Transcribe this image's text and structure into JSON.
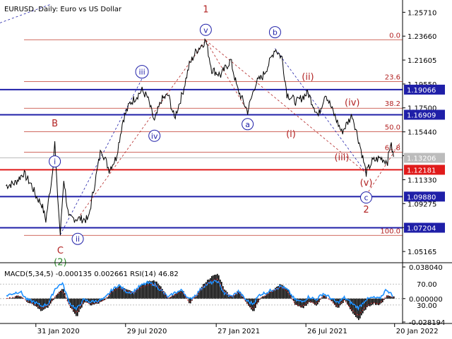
{
  "chart_data": {
    "type": "line",
    "title": "EURUSD, Daily:  Euro vs US Dollar",
    "price_axis": {
      "ticks": [
        "1.25710",
        "1.23660",
        "1.21605",
        "1.19550",
        "1.17500",
        "1.15440",
        "1.13390",
        "1.11330",
        "1.09275",
        "1.07220",
        "1.05165"
      ],
      "ylim": [
        1.042,
        1.264
      ]
    },
    "time_axis": {
      "ticks": [
        "31 Jan 2020",
        "29 Jul 2020",
        "27 Jan 2021",
        "26 Jul 2021",
        "20 Jan 2022"
      ]
    },
    "fib_levels": [
      {
        "label": "0.0",
        "price": 1.2335
      },
      {
        "label": "23.6",
        "price": 1.1975
      },
      {
        "label": "38.2",
        "price": 1.1747
      },
      {
        "label": "50.0",
        "price": 1.1545
      },
      {
        "label": "61.8",
        "price": 1.137
      },
      {
        "label": "100.0",
        "price": 1.0655
      }
    ],
    "horizontal_levels": [
      {
        "price": 1.19066,
        "label": "1.19066",
        "color": "#1f1fa8"
      },
      {
        "price": 1.16909,
        "label": "1.16909",
        "color": "#1f1fa8"
      },
      {
        "price": 1.12181,
        "label": "1.12181",
        "color": "#e01b1b"
      },
      {
        "price": 1.0988,
        "label": "1.09880",
        "color": "#1f1fa8"
      },
      {
        "price": 1.07204,
        "label": "1.07204",
        "color": "#1f1fa8"
      }
    ],
    "current_price": {
      "price": 1.13206,
      "label": "1.13206",
      "color": "#bcbcbc"
    },
    "price_series": [
      {
        "date": "2019-12-02",
        "close": 1.1082
      },
      {
        "date": "2019-12-20",
        "close": 1.1105
      },
      {
        "date": "2020-01-06",
        "close": 1.119
      },
      {
        "date": "2020-01-22",
        "close": 1.109
      },
      {
        "date": "2020-01-31",
        "close": 1.0995
      },
      {
        "date": "2020-02-12",
        "close": 1.092
      },
      {
        "date": "2020-02-20",
        "close": 1.0785
      },
      {
        "date": "2020-03-03",
        "close": 1.115
      },
      {
        "date": "2020-03-09",
        "close": 1.145
      },
      {
        "date": "2020-03-13",
        "close": 1.11
      },
      {
        "date": "2020-03-20",
        "close": 1.066
      },
      {
        "date": "2020-03-27",
        "close": 1.114
      },
      {
        "date": "2020-04-06",
        "close": 1.08
      },
      {
        "date": "2020-04-24",
        "close": 1.08
      },
      {
        "date": "2020-05-15",
        "close": 1.079
      },
      {
        "date": "2020-05-29",
        "close": 1.112
      },
      {
        "date": "2020-06-10",
        "close": 1.14
      },
      {
        "date": "2020-06-26",
        "close": 1.122
      },
      {
        "date": "2020-07-10",
        "close": 1.132
      },
      {
        "date": "2020-07-24",
        "close": 1.165
      },
      {
        "date": "2020-08-07",
        "close": 1.179
      },
      {
        "date": "2020-08-31",
        "close": 1.19
      },
      {
        "date": "2020-09-11",
        "close": 1.184
      },
      {
        "date": "2020-09-25",
        "close": 1.163
      },
      {
        "date": "2020-10-09",
        "close": 1.182
      },
      {
        "date": "2020-10-23",
        "close": 1.186
      },
      {
        "date": "2020-11-04",
        "close": 1.166
      },
      {
        "date": "2020-11-20",
        "close": 1.187
      },
      {
        "date": "2020-12-04",
        "close": 1.212
      },
      {
        "date": "2020-12-18",
        "close": 1.224
      },
      {
        "date": "2021-01-06",
        "close": 1.233
      },
      {
        "date": "2021-01-18",
        "close": 1.208
      },
      {
        "date": "2021-02-05",
        "close": 1.203
      },
      {
        "date": "2021-02-25",
        "close": 1.216
      },
      {
        "date": "2021-03-10",
        "close": 1.192
      },
      {
        "date": "2021-03-31",
        "close": 1.172
      },
      {
        "date": "2021-04-16",
        "close": 1.196
      },
      {
        "date": "2021-04-30",
        "close": 1.202
      },
      {
        "date": "2021-05-14",
        "close": 1.214
      },
      {
        "date": "2021-05-25",
        "close": 1.226
      },
      {
        "date": "2021-06-08",
        "close": 1.218
      },
      {
        "date": "2021-06-18",
        "close": 1.187
      },
      {
        "date": "2021-07-07",
        "close": 1.18
      },
      {
        "date": "2021-07-30",
        "close": 1.188
      },
      {
        "date": "2021-08-20",
        "close": 1.168
      },
      {
        "date": "2021-09-03",
        "close": 1.188
      },
      {
        "date": "2021-09-17",
        "close": 1.173
      },
      {
        "date": "2021-10-06",
        "close": 1.154
      },
      {
        "date": "2021-10-27",
        "close": 1.169
      },
      {
        "date": "2021-11-12",
        "close": 1.142
      },
      {
        "date": "2021-11-24",
        "close": 1.119
      },
      {
        "date": "2021-12-06",
        "close": 1.129
      },
      {
        "date": "2021-12-22",
        "close": 1.132
      },
      {
        "date": "2022-01-06",
        "close": 1.129
      },
      {
        "date": "2022-01-12",
        "close": 1.145
      },
      {
        "date": "2022-01-18",
        "close": 1.133
      }
    ],
    "wave_labels": [
      {
        "text": "B",
        "date": "2020-03-09",
        "price": 1.162,
        "color": "#b22222",
        "circle": false
      },
      {
        "text": "i",
        "date": "2020-03-09",
        "price": 1.129,
        "color": "#1f1fa8",
        "circle": true
      },
      {
        "text": "C",
        "date": "2020-03-20",
        "price": 1.053,
        "color": "#b22222",
        "circle": false
      },
      {
        "text": "(2)",
        "date": "2020-03-20",
        "price": 1.043,
        "color": "#2e8b2e",
        "circle": false
      },
      {
        "text": "ii",
        "date": "2020-04-24",
        "price": 1.0625,
        "color": "#1f1fa8",
        "circle": true
      },
      {
        "text": "iii",
        "date": "2020-08-31",
        "price": 1.206,
        "color": "#1f1fa8",
        "circle": true
      },
      {
        "text": "iv",
        "date": "2020-09-25",
        "price": 1.151,
        "color": "#1f1fa8",
        "circle": true
      },
      {
        "text": "1",
        "date": "2021-01-06",
        "price": 1.26,
        "color": "#b22222",
        "circle": false
      },
      {
        "text": "v",
        "date": "2021-01-06",
        "price": 1.242,
        "color": "#1f1fa8",
        "circle": true
      },
      {
        "text": "a",
        "date": "2021-03-31",
        "price": 1.161,
        "color": "#1f1fa8",
        "circle": true
      },
      {
        "text": "b",
        "date": "2021-05-25",
        "price": 1.24,
        "color": "#1f1fa8",
        "circle": true
      },
      {
        "text": "(ii)",
        "date": "2021-07-30",
        "price": 1.202,
        "color": "#b22222",
        "circle": false
      },
      {
        "text": "(i)",
        "date": "2021-06-26",
        "price": 1.153,
        "color": "#b22222",
        "circle": false
      },
      {
        "text": "(iv)",
        "date": "2021-10-27",
        "price": 1.18,
        "color": "#b22222",
        "circle": false
      },
      {
        "text": "(iii)",
        "date": "2021-10-06",
        "price": 1.133,
        "color": "#b22222",
        "circle": false
      },
      {
        "text": "(v)",
        "date": "2021-11-24",
        "price": 1.111,
        "color": "#b22222",
        "circle": false
      },
      {
        "text": "c",
        "date": "2021-11-24",
        "price": 1.098,
        "color": "#1f1fa8",
        "circle": true
      },
      {
        "text": "2",
        "date": "2021-11-24",
        "price": 1.088,
        "color": "#b22222",
        "circle": false
      }
    ],
    "indicator": {
      "label": "MACD(5,34,5) -0.000135 0.002661 RSI(14) 46.82",
      "left_ticks": [
        "0.038040",
        "0.000000",
        "-0.028194"
      ],
      "right_ticks": [
        "70.00",
        "30.00"
      ],
      "macd_hist": [
        0.0,
        0.002,
        0.004,
        -0.004,
        -0.008,
        -0.015,
        -0.01,
        0.004,
        0.012,
        -0.01,
        -0.022,
        -0.004,
        -0.008,
        -0.006,
        -0.002,
        0.01,
        0.016,
        0.012,
        0.008,
        0.016,
        0.02,
        0.022,
        0.014,
        0.0,
        0.006,
        0.01,
        -0.006,
        0.004,
        0.018,
        0.026,
        0.03,
        0.01,
        0.002,
        0.01,
        -0.004,
        -0.016,
        0.0,
        0.006,
        0.012,
        0.018,
        0.01,
        -0.008,
        -0.012,
        -0.004,
        -0.008,
        0.004,
        -0.002,
        -0.012,
        -0.002,
        -0.016,
        -0.026,
        -0.012,
        -0.006,
        -0.008,
        0.004,
        0.002
      ],
      "rsi": [
        48,
        52,
        56,
        40,
        36,
        28,
        32,
        62,
        72,
        34,
        22,
        40,
        36,
        38,
        42,
        58,
        68,
        56,
        54,
        66,
        72,
        70,
        58,
        44,
        54,
        58,
        40,
        50,
        66,
        72,
        76,
        52,
        46,
        56,
        40,
        32,
        50,
        54,
        60,
        66,
        58,
        40,
        36,
        46,
        40,
        52,
        44,
        34,
        44,
        34,
        24,
        40,
        44,
        42,
        60,
        46
      ]
    }
  }
}
